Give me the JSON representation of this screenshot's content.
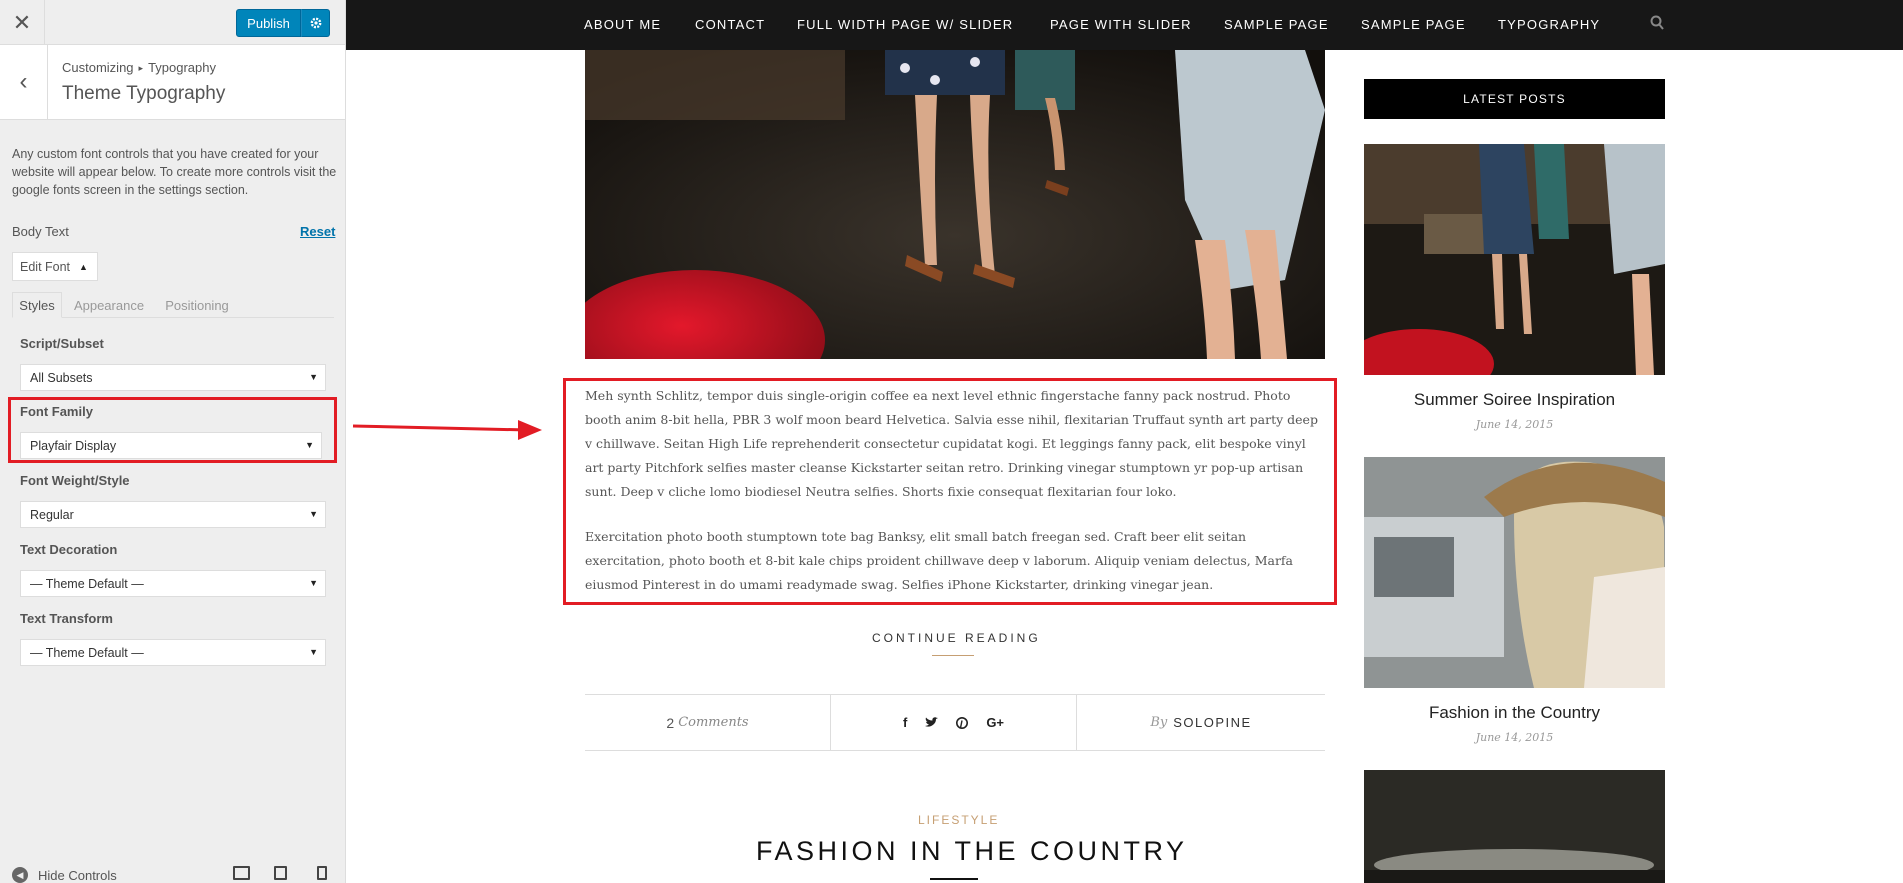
{
  "customizer": {
    "publish_label": "Publish",
    "breadcrumb_root": "Customizing",
    "breadcrumb_separator": "▸",
    "breadcrumb_current": "Typography",
    "section_title": "Theme Typography",
    "description": "Any custom font controls that you have created for your website will appear below. To create more controls visit the google fonts screen in the settings section.",
    "group_label": "Body Text",
    "reset_label": "Reset",
    "edit_font_label": "Edit Font",
    "tabs": [
      {
        "label": "Styles",
        "active": true
      },
      {
        "label": "Appearance",
        "active": false
      },
      {
        "label": "Positioning",
        "active": false
      }
    ],
    "fields": [
      {
        "label": "Script/Subset",
        "value": "All Subsets"
      },
      {
        "label": "Font Family",
        "value": "Playfair Display"
      },
      {
        "label": "Font Weight/Style",
        "value": "Regular"
      },
      {
        "label": "Text Decoration",
        "value": "— Theme Default —"
      },
      {
        "label": "Text Transform",
        "value": "— Theme Default —"
      }
    ],
    "hide_controls_label": "Hide Controls",
    "devices": [
      "desktop-icon",
      "tablet-icon",
      "mobile-icon"
    ],
    "highlight_color": "#e21c24"
  },
  "nav": {
    "items": [
      "ABOUT ME",
      "CONTACT",
      "FULL WIDTH PAGE W/ SLIDER",
      "PAGE WITH SLIDER",
      "SAMPLE PAGE",
      "SAMPLE PAGE",
      "TYPOGRAPHY"
    ],
    "search_icon": "search-icon"
  },
  "post": {
    "paragraphs": [
      "Meh synth Schlitz, tempor duis single-origin coffee ea next level ethnic fingerstache fanny pack nostrud. Photo booth anim 8-bit hella, PBR 3 wolf moon beard Helvetica. Salvia esse nihil, flexitarian Truffaut synth art party deep v chillwave. Seitan High Life reprehenderit consectetur cupidatat kogi. Et leggings fanny pack, elit bespoke vinyl art party Pitchfork selfies master cleanse Kickstarter seitan retro. Drinking vinegar stumptown yr pop-up artisan sunt. Deep v cliche lomo biodiesel Neutra selfies. Shorts fixie consequat flexitarian four loko.",
      "Exercitation photo booth stumptown tote bag Banksy, elit small batch freegan sed. Craft beer elit seitan exercitation, photo booth et 8-bit kale chips proident chillwave deep v laborum. Aliquip veniam delectus, Marfa eiusmod Pinterest in do umami readymade swag. Selfies iPhone Kickstarter, drinking vinegar jean."
    ],
    "continue_label": "CONTINUE READING",
    "comments_count": "2",
    "comments_label": "Comments",
    "share_icons": [
      "facebook-icon",
      "twitter-icon",
      "pinterest-icon",
      "google-plus-icon"
    ],
    "by_label": "By",
    "author": "SOLOPINE",
    "accent_color": "#c69f73"
  },
  "next_post": {
    "category": "LIFESTYLE",
    "title": "FASHION IN THE COUNTRY"
  },
  "widget": {
    "title": "LATEST POSTS",
    "posts": [
      {
        "title": "Summer Soiree Inspiration",
        "date": "June 14, 2015"
      },
      {
        "title": "Fashion in the Country",
        "date": "June 14, 2015"
      }
    ]
  }
}
